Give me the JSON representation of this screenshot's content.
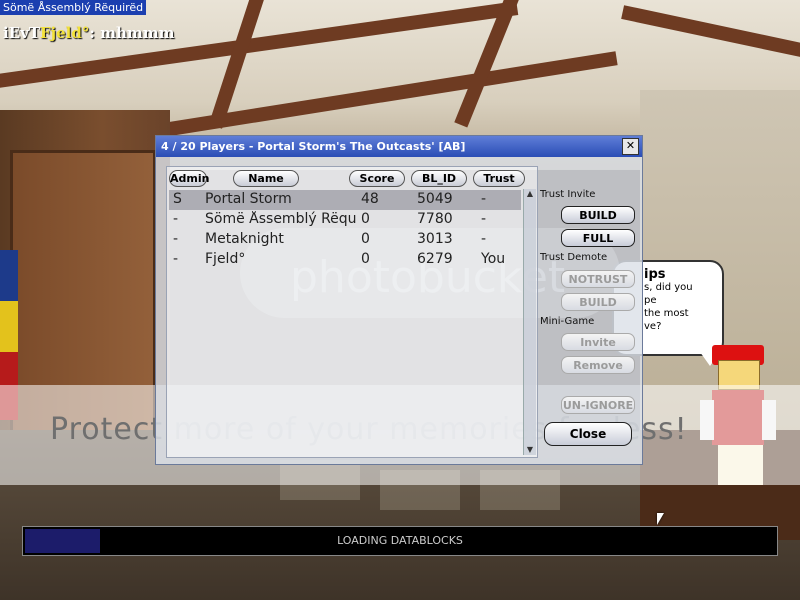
{
  "top_title": "Sömë Åssemblý Rëquirëd",
  "chat": {
    "name_prefix": "iEvT",
    "name_main": "Fjeld°",
    "message": ": mhmmm"
  },
  "tip": {
    "title": "ips",
    "lines": [
      "s, did you",
      "pe",
      "the most",
      "ve?"
    ]
  },
  "dialog": {
    "title": "4 / 20 Players - Portal Storm's The Outcasts' [AB]",
    "close_icon": "close-icon",
    "columns": [
      "Admin",
      "Name",
      "Score",
      "BL_ID",
      "Trust"
    ],
    "rows": [
      {
        "admin": "S",
        "name": "Portal Storm",
        "score": "48",
        "bl_id": "5049",
        "trust": "-"
      },
      {
        "admin": "-",
        "name": "Sömë Åssemblý Rëqu",
        "score": "0",
        "bl_id": "7780",
        "trust": "-"
      },
      {
        "admin": "-",
        "name": "Metaknight",
        "score": "0",
        "bl_id": "3013",
        "trust": "-"
      },
      {
        "admin": "-",
        "name": "Fjeld°",
        "score": "0",
        "bl_id": "6279",
        "trust": "You"
      }
    ],
    "trust_invite_label": "Trust Invite",
    "build_button": "BUILD",
    "full_button": "FULL",
    "trust_demote_label": "Trust Demote",
    "notrust_button": "NOTRUST",
    "demote_build_button": "BUILD",
    "minigame_label": "Mini-Game",
    "invite_button": "Invite",
    "remove_button": "Remove",
    "unignore_button": "UN-IGNORE",
    "close_button": "Close"
  },
  "watermark": {
    "logo": "photobucket",
    "text": "Protect more of your memories for less!"
  },
  "loading": {
    "text": "LOADING DATABLOCKS",
    "progress": 0.1
  }
}
